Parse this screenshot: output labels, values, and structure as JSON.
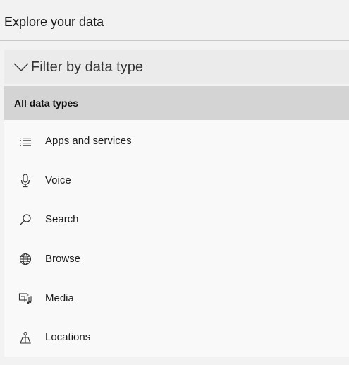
{
  "page": {
    "title": "Explore your data"
  },
  "filter": {
    "label": "Filter by data type",
    "expanded": true
  },
  "data_types": {
    "all_label": "All data types",
    "items": [
      {
        "label": "Apps and services",
        "icon": "list-icon"
      },
      {
        "label": "Voice",
        "icon": "microphone-icon"
      },
      {
        "label": "Search",
        "icon": "search-icon"
      },
      {
        "label": "Browse",
        "icon": "globe-icon"
      },
      {
        "label": "Media",
        "icon": "media-icon"
      },
      {
        "label": "Locations",
        "icon": "location-icon"
      }
    ]
  },
  "colors": {
    "background": "#f2f2f2",
    "header": "#ebebeb",
    "selected_row": "#d4d4d4",
    "panel": "#f9f9f9"
  }
}
